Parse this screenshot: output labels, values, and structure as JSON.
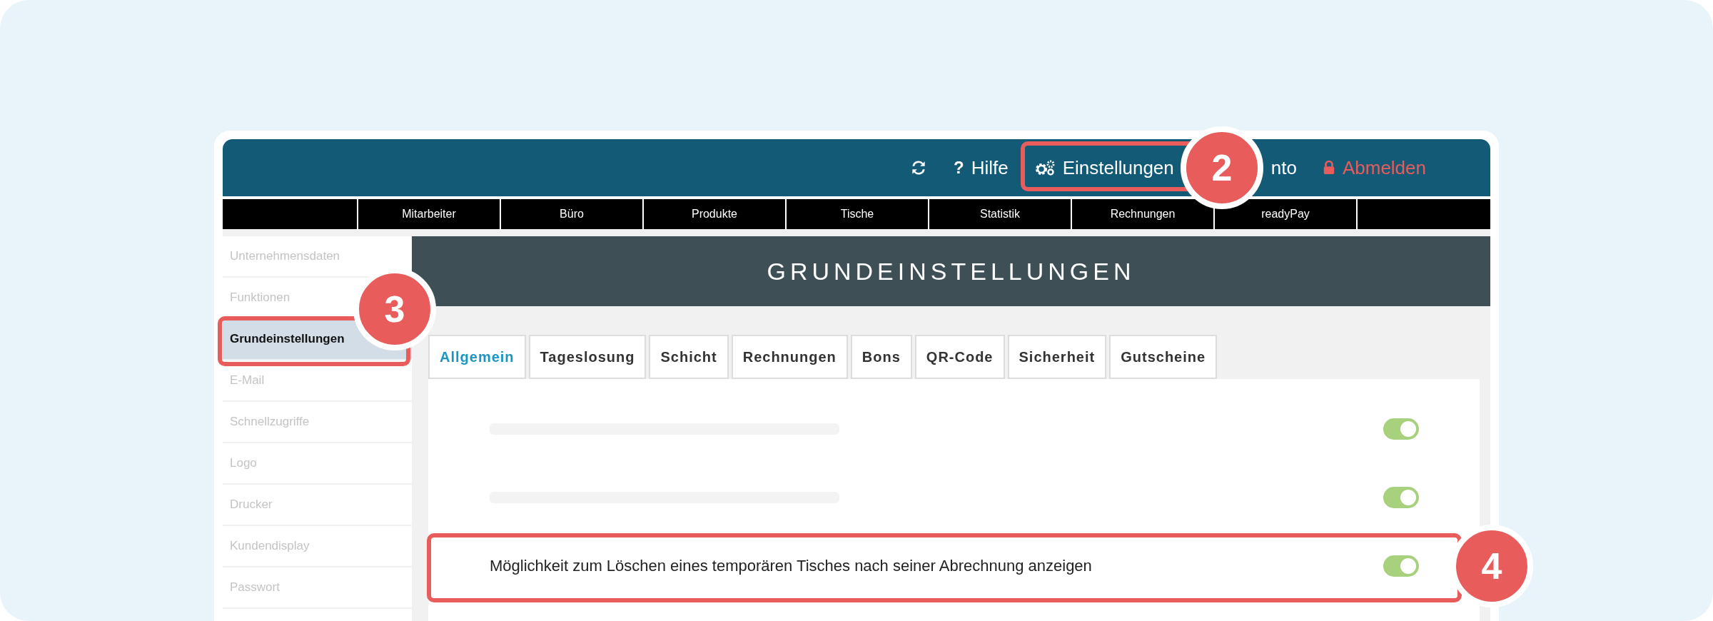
{
  "topbar": {
    "items": [
      {
        "kind": "refresh"
      },
      {
        "kind": "help",
        "icon": "?",
        "label": "Hilfe"
      },
      {
        "kind": "settings",
        "label": "Einstellungen"
      },
      {
        "kind": "plain",
        "label": "nto"
      },
      {
        "kind": "logout",
        "label": "Abmelden"
      }
    ]
  },
  "nav": {
    "items": [
      "Mitarbeiter",
      "Büro",
      "Produkte",
      "Tische",
      "Statistik",
      "Rechnungen",
      "readyPay"
    ]
  },
  "sidebar": {
    "items": [
      {
        "label": "Unternehmensdaten",
        "selected": false
      },
      {
        "label": "Funktionen",
        "selected": false
      },
      {
        "label": "Grundeinstellungen",
        "selected": true
      },
      {
        "label": "E-Mail",
        "selected": false
      },
      {
        "label": "Schnellzugriffe",
        "selected": false
      },
      {
        "label": "Logo",
        "selected": false
      },
      {
        "label": "Drucker",
        "selected": false
      },
      {
        "label": "Kundendisplay",
        "selected": false
      },
      {
        "label": "Passwort",
        "selected": false
      }
    ]
  },
  "header": {
    "title": "GRUNDEINSTELLUNGEN"
  },
  "tabs": [
    {
      "label": "Allgemein",
      "selected": true
    },
    {
      "label": "Tageslosung",
      "selected": false
    },
    {
      "label": "Schicht",
      "selected": false
    },
    {
      "label": "Rechnungen",
      "selected": false
    },
    {
      "label": "Bons",
      "selected": false
    },
    {
      "label": "QR-Code",
      "selected": false
    },
    {
      "label": "Sicherheit",
      "selected": false
    },
    {
      "label": "Gutscheine",
      "selected": false
    }
  ],
  "settings": [
    {
      "kind": "placeholder",
      "on": true
    },
    {
      "kind": "placeholder",
      "on": true
    },
    {
      "kind": "text",
      "label": "Möglichkeit zum Löschen eines temporären Tisches nach seiner Abrechnung anzeigen",
      "on": true
    }
  ],
  "annotations": [
    {
      "number": "2"
    },
    {
      "number": "3"
    },
    {
      "number": "4"
    }
  ]
}
